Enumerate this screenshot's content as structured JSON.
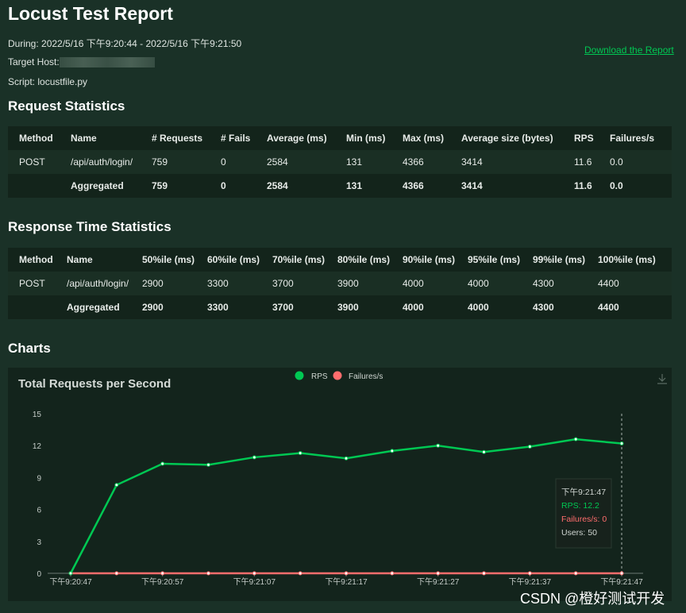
{
  "title": "Locust Test Report",
  "during_label": "During:",
  "during": "2022/5/16 下午9:20:44 - 2022/5/16 下午9:21:50",
  "host_label": "Target Host:",
  "script_label": "Script:",
  "script": "locustfile.py",
  "download": "Download the Report",
  "req_stats": {
    "title": "Request Statistics",
    "headers": [
      "Method",
      "Name",
      "# Requests",
      "# Fails",
      "Average (ms)",
      "Min (ms)",
      "Max (ms)",
      "Average size (bytes)",
      "RPS",
      "Failures/s"
    ],
    "rows": [
      [
        "POST",
        "/api/auth/login/",
        "759",
        "0",
        "2584",
        "131",
        "4366",
        "3414",
        "11.6",
        "0.0"
      ],
      [
        "",
        "Aggregated",
        "759",
        "0",
        "2584",
        "131",
        "4366",
        "3414",
        "11.6",
        "0.0"
      ]
    ]
  },
  "resp_stats": {
    "title": "Response Time Statistics",
    "headers": [
      "Method",
      "Name",
      "50%ile (ms)",
      "60%ile (ms)",
      "70%ile (ms)",
      "80%ile (ms)",
      "90%ile (ms)",
      "95%ile (ms)",
      "99%ile (ms)",
      "100%ile (ms)"
    ],
    "rows": [
      [
        "POST",
        "/api/auth/login/",
        "2900",
        "3300",
        "3700",
        "3900",
        "4000",
        "4000",
        "4300",
        "4400"
      ],
      [
        "",
        "Aggregated",
        "2900",
        "3300",
        "3700",
        "3900",
        "4000",
        "4000",
        "4300",
        "4400"
      ]
    ]
  },
  "charts_title": "Charts",
  "chart_data": {
    "type": "line",
    "title": "Total Requests per Second",
    "x": [
      "下午9:20:47",
      "下午9:20:52",
      "下午9:20:57",
      "下午9:21:02",
      "下午9:21:07",
      "下午9:21:12",
      "下午9:21:17",
      "下午9:21:22",
      "下午9:21:27",
      "下午9:21:32",
      "下午9:21:37",
      "下午9:21:42",
      "下午9:21:47"
    ],
    "xticks": [
      "下午9:20:47",
      "下午9:20:57",
      "下午9:21:07",
      "下午9:21:17",
      "下午9:21:27",
      "下午9:21:37",
      "下午9:21:47"
    ],
    "yticks": [
      "0",
      "3",
      "6",
      "9",
      "12",
      "15"
    ],
    "ylim": [
      0,
      15
    ],
    "series": [
      {
        "name": "RPS",
        "color": "#00c853",
        "values": [
          0,
          8.3,
          10.3,
          10.2,
          10.9,
          11.3,
          10.8,
          11.5,
          12.0,
          11.4,
          11.9,
          12.6,
          12.2
        ]
      },
      {
        "name": "Failures/s",
        "color": "#ff6d6d",
        "values": [
          0,
          0,
          0,
          0,
          0,
          0,
          0,
          0,
          0,
          0,
          0,
          0,
          0
        ]
      }
    ],
    "legend": "top-center",
    "tooltip": {
      "time": "下午9:21:47",
      "rps": "RPS: 12.2",
      "fails": "Failures/s: 0",
      "users": "Users: 50"
    }
  },
  "watermark": "CSDN @橙好测试开发"
}
